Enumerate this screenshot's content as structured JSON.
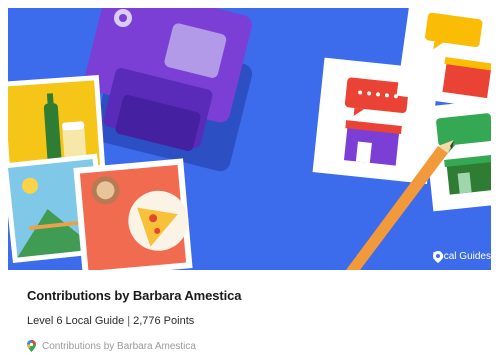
{
  "banner": {
    "brand_label": "Local Guides",
    "colors": {
      "background": "#3c6bec",
      "camera": "#7b3fd6",
      "pencil": "#f29a3b",
      "red": "#ea4335",
      "yellow": "#fbbc05",
      "green": "#34a853"
    }
  },
  "profile": {
    "title": "Contributions by Barbara Amestica",
    "level": "Level 6 Local Guide",
    "separator": "|",
    "points": "2,776 Points",
    "attribution": "Contributions by Barbara Amestica"
  }
}
